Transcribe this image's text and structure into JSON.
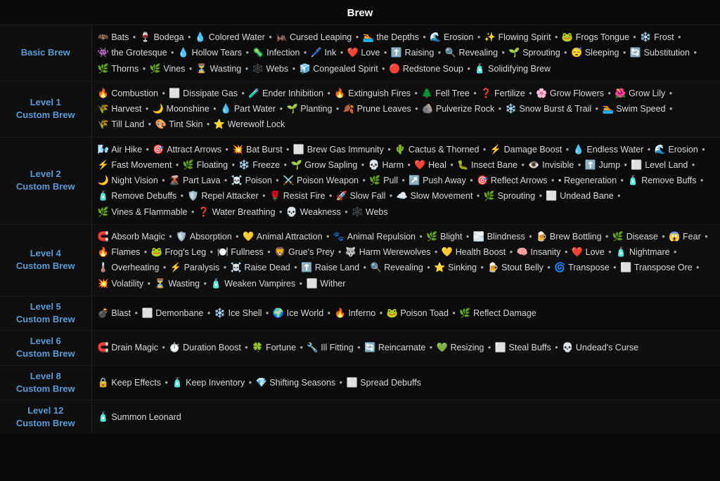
{
  "title": "Brew",
  "rows": [
    {
      "label": "Basic Brew",
      "items": [
        {
          "icon": "🦇",
          "name": "Bats"
        },
        {
          "icon": "🍷",
          "name": "Bodega"
        },
        {
          "icon": "💧",
          "name": "Colored Water"
        },
        {
          "icon": "🦗",
          "name": "Cursed Leaping"
        },
        {
          "icon": "🏊",
          "name": "the Depths"
        },
        {
          "icon": "🌊",
          "name": "Erosion"
        },
        {
          "icon": "✨",
          "name": "Flowing Spirit"
        },
        {
          "icon": "🐸",
          "name": "Frogs Tongue"
        },
        {
          "icon": "❄️",
          "name": "Frost"
        },
        {
          "icon": "👾",
          "name": "the Grotesque"
        },
        {
          "icon": "💧",
          "name": "Hollow Tears"
        },
        {
          "icon": "🦠",
          "name": "Infection"
        },
        {
          "icon": "🖊️",
          "name": "Ink"
        },
        {
          "icon": "❤️",
          "name": "Love"
        },
        {
          "icon": "⬆️",
          "name": "Raising"
        },
        {
          "icon": "🔍",
          "name": "Revealing"
        },
        {
          "icon": "🌱",
          "name": "Sprouting"
        },
        {
          "icon": "😴",
          "name": "Sleeping"
        },
        {
          "icon": "🔄",
          "name": "Substitution"
        },
        {
          "icon": "🌿",
          "name": "Thorns"
        },
        {
          "icon": "🌿",
          "name": "Vines"
        },
        {
          "icon": "⏳",
          "name": "Wasting"
        },
        {
          "icon": "🕸️",
          "name": "Webs"
        },
        {
          "icon": "🧊",
          "name": "Congealed Spirit"
        },
        {
          "icon": "🔴",
          "name": "Redstone Soup"
        },
        {
          "icon": "🧴",
          "name": "Solidifying Brew"
        }
      ]
    },
    {
      "label": "Level 1\nCustom Brew",
      "items": [
        {
          "icon": "🔥",
          "name": "Combustion"
        },
        {
          "icon": "⬜",
          "name": "Dissipate Gas"
        },
        {
          "icon": "🧪",
          "name": "Ender Inhibition"
        },
        {
          "icon": "🔥",
          "name": "Extinguish Fires"
        },
        {
          "icon": "🌲",
          "name": "Fell Tree"
        },
        {
          "icon": "❓",
          "name": "Fertilize"
        },
        {
          "icon": "🌸",
          "name": "Grow Flowers"
        },
        {
          "icon": "🌺",
          "name": "Grow Lily"
        },
        {
          "icon": "🌾",
          "name": "Harvest"
        },
        {
          "icon": "🌙",
          "name": "Moonshine"
        },
        {
          "icon": "💧",
          "name": "Part Water"
        },
        {
          "icon": "🌱",
          "name": "Planting"
        },
        {
          "icon": "🍂",
          "name": "Prune Leaves"
        },
        {
          "icon": "🪨",
          "name": "Pulverize Rock"
        },
        {
          "icon": "❄️",
          "name": "Snow Burst & Trail"
        },
        {
          "icon": "🏊",
          "name": "Swim Speed"
        },
        {
          "icon": "🌾",
          "name": "Till Land"
        },
        {
          "icon": "🎨",
          "name": "Tint Skin"
        },
        {
          "icon": "⭐",
          "name": "Werewolf Lock"
        }
      ]
    },
    {
      "label": "Level 2\nCustom Brew",
      "items": [
        {
          "icon": "🌬️",
          "name": "Air Hike"
        },
        {
          "icon": "🎯",
          "name": "Attract Arrows"
        },
        {
          "icon": "💥",
          "name": "Bat Burst"
        },
        {
          "icon": "⬜",
          "name": "Brew Gas Immunity"
        },
        {
          "icon": "🌵",
          "name": "Cactus & Thorned"
        },
        {
          "icon": "⚡",
          "name": "Damage Boost"
        },
        {
          "icon": "💧",
          "name": "Endless Water"
        },
        {
          "icon": "🌊",
          "name": "Erosion"
        },
        {
          "icon": "⚡",
          "name": "Fast Movement"
        },
        {
          "icon": "🌿",
          "name": "Floating"
        },
        {
          "icon": "❄️",
          "name": "Freeze"
        },
        {
          "icon": "🌱",
          "name": "Grow Sapling"
        },
        {
          "icon": "💀",
          "name": "Harm"
        },
        {
          "icon": "❤️",
          "name": "Heal"
        },
        {
          "icon": "🐛",
          "name": "Insect Bane"
        },
        {
          "icon": "👁️",
          "name": "Invisible"
        },
        {
          "icon": "⬆️",
          "name": "Jump"
        },
        {
          "icon": "⬜",
          "name": "Level Land"
        },
        {
          "icon": "🌙",
          "name": "Night Vision"
        },
        {
          "icon": "🌋",
          "name": "Part Lava"
        },
        {
          "icon": "☠️",
          "name": "Poison"
        },
        {
          "icon": "⚔️",
          "name": "Poison Weapon"
        },
        {
          "icon": "🌿",
          "name": "Pull"
        },
        {
          "icon": "↗️",
          "name": "Push Away"
        },
        {
          "icon": "🎯",
          "name": "Reflect Arrows"
        },
        {
          "icon": "•",
          "name": "Regeneration"
        },
        {
          "icon": "🧴",
          "name": "Remove Buffs"
        },
        {
          "icon": "🧴",
          "name": "Remove Debuffs"
        },
        {
          "icon": "🛡️",
          "name": "Repel Attacker"
        },
        {
          "icon": "🌹",
          "name": "Resist Fire"
        },
        {
          "icon": "🚀",
          "name": "Slow Fall"
        },
        {
          "icon": "☁️",
          "name": "Slow Movement"
        },
        {
          "icon": "🌿",
          "name": "Sprouting"
        },
        {
          "icon": "⬜",
          "name": "Undead Bane"
        },
        {
          "icon": "🌿",
          "name": "Vines & Flammable"
        },
        {
          "icon": "❓",
          "name": "Water Breathing"
        },
        {
          "icon": "💀",
          "name": "Weakness"
        },
        {
          "icon": "🕸️",
          "name": "Webs"
        }
      ]
    },
    {
      "label": "Level 4\nCustom Brew",
      "items": [
        {
          "icon": "🧲",
          "name": "Absorb Magic"
        },
        {
          "icon": "🛡️",
          "name": "Absorption"
        },
        {
          "icon": "💛",
          "name": "Animal Attraction"
        },
        {
          "icon": "🐾",
          "name": "Animal Repulsion"
        },
        {
          "icon": "🌿",
          "name": "Blight"
        },
        {
          "icon": "🌫️",
          "name": "Blindness"
        },
        {
          "icon": "🍺",
          "name": "Brew Bottling"
        },
        {
          "icon": "🌿",
          "name": "Disease"
        },
        {
          "icon": "😱",
          "name": "Fear"
        },
        {
          "icon": "🔥",
          "name": "Flames"
        },
        {
          "icon": "🐸",
          "name": "Frog's Leg"
        },
        {
          "icon": "🍽️",
          "name": "Fullness"
        },
        {
          "icon": "🦁",
          "name": "Grue's Prey"
        },
        {
          "icon": "🐺",
          "name": "Harm Werewolves"
        },
        {
          "icon": "💛",
          "name": "Health Boost"
        },
        {
          "icon": "🧠",
          "name": "Insanity"
        },
        {
          "icon": "❤️",
          "name": "Love"
        },
        {
          "icon": "🧴",
          "name": "Nightmare"
        },
        {
          "icon": "🌡️",
          "name": "Overheating"
        },
        {
          "icon": "⚡",
          "name": "Paralysis"
        },
        {
          "icon": "☠️",
          "name": "Raise Dead"
        },
        {
          "icon": "⬆️",
          "name": "Raise Land"
        },
        {
          "icon": "🔍",
          "name": "Revealing"
        },
        {
          "icon": "⭐",
          "name": "Sinking"
        },
        {
          "icon": "🍺",
          "name": "Stout Belly"
        },
        {
          "icon": "🌀",
          "name": "Transpose"
        },
        {
          "icon": "⬜",
          "name": "Transpose Ore"
        },
        {
          "icon": "💥",
          "name": "Volatility"
        },
        {
          "icon": "⏳",
          "name": "Wasting"
        },
        {
          "icon": "🧴",
          "name": "Weaken Vampires"
        },
        {
          "icon": "⬜",
          "name": "Wither"
        }
      ]
    },
    {
      "label": "Level 5\nCustom Brew",
      "items": [
        {
          "icon": "💣",
          "name": "Blast"
        },
        {
          "icon": "⬜",
          "name": "Demonbane"
        },
        {
          "icon": "❄️",
          "name": "Ice Shell"
        },
        {
          "icon": "🌍",
          "name": "Ice World"
        },
        {
          "icon": "🔥",
          "name": "Inferno"
        },
        {
          "icon": "🐸",
          "name": "Poison Toad"
        },
        {
          "icon": "🌿",
          "name": "Reflect Damage"
        }
      ]
    },
    {
      "label": "Level 6\nCustom Brew",
      "items": [
        {
          "icon": "🧲",
          "name": "Drain Magic"
        },
        {
          "icon": "⏱️",
          "name": "Duration Boost"
        },
        {
          "icon": "🍀",
          "name": "Fortune"
        },
        {
          "icon": "🔧",
          "name": "Ill Fitting"
        },
        {
          "icon": "🔄",
          "name": "Reincarnate"
        },
        {
          "icon": "💚",
          "name": "Resizing"
        },
        {
          "icon": "⬜",
          "name": "Steal Buffs"
        },
        {
          "icon": "💀",
          "name": "Undead's Curse"
        }
      ]
    },
    {
      "label": "Level 8\nCustom Brew",
      "items": [
        {
          "icon": "🔒",
          "name": "Keep Effects"
        },
        {
          "icon": "🧴",
          "name": "Keep Inventory"
        },
        {
          "icon": "💎",
          "name": "Shifting Seasons"
        },
        {
          "icon": "⬜",
          "name": "Spread Debuffs"
        }
      ]
    },
    {
      "label": "Level 12\nCustom Brew",
      "items": [
        {
          "icon": "🧴",
          "name": "Summon Leonard"
        }
      ]
    }
  ]
}
